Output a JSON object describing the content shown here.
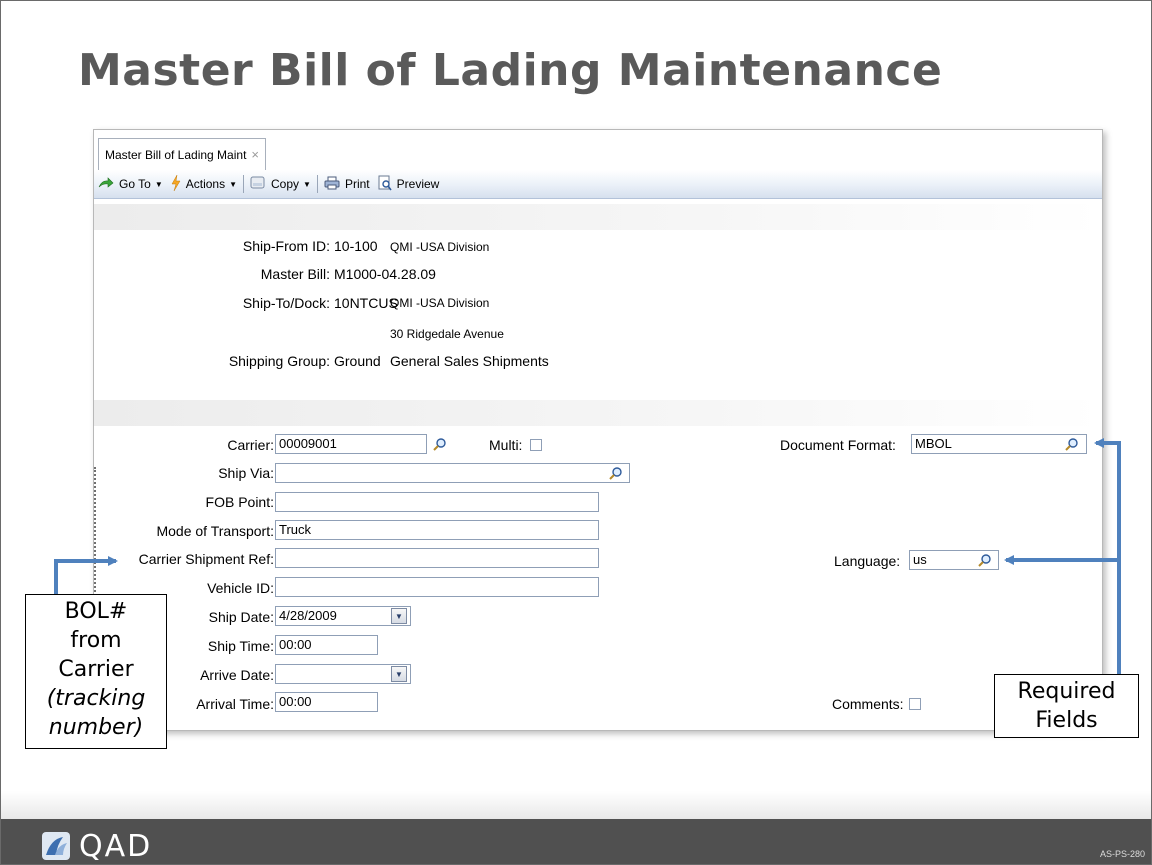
{
  "slide": {
    "title": "Master Bill of Lading Maintenance",
    "brand": "QAD",
    "code": "AS-PS-280"
  },
  "app": {
    "tab_label": "Master Bill of Lading Maint",
    "tab_close": "×",
    "toolbar": {
      "goto": "Go To",
      "actions": "Actions",
      "copy": "Copy",
      "print": "Print",
      "preview": "Preview"
    },
    "header": {
      "ship_from_label": "Ship-From ID:",
      "ship_from_value": "10-100",
      "ship_from_desc": "QMI -USA Division",
      "master_bill_label": "Master Bill:",
      "master_bill_value": "M1000-04.28.09",
      "ship_to_label": "Ship-To/Dock:",
      "ship_to_value": "10NTCUS",
      "ship_to_desc": "QMI -USA Division",
      "ship_to_address": "30 Ridgedale Avenue",
      "shipping_group_label": "Shipping Group:",
      "shipping_group_value": "Ground",
      "shipping_group_desc": "General Sales Shipments"
    },
    "form": {
      "carrier_label": "Carrier:",
      "carrier_value": "00009001",
      "multi_label": "Multi:",
      "document_format_label": "Document Format:",
      "document_format_value": "MBOL",
      "ship_via_label": "Ship Via:",
      "ship_via_value": "",
      "fob_label": "FOB Point:",
      "fob_value": "",
      "mode_label": "Mode of Transport:",
      "mode_value": "Truck",
      "carrier_ref_label": "Carrier Shipment Ref:",
      "carrier_ref_value": "",
      "language_label": "Language:",
      "language_value": "us",
      "vehicle_label": "Vehicle ID:",
      "vehicle_value": "",
      "ship_date_label": "Ship Date:",
      "ship_date_value": "4/28/2009",
      "ship_time_label": "Ship Time:",
      "ship_time_value": "00:00",
      "arrive_date_label": "Arrive Date:",
      "arrive_date_value": "",
      "arrival_time_label": "Arrival Time:",
      "arrival_time_value": "00:00",
      "comments_label": "Comments:"
    }
  },
  "callouts": {
    "bol": {
      "line1": "BOL#",
      "line2": "from",
      "line3": "Carrier",
      "line4": "(tracking",
      "line5": "number)"
    },
    "required": {
      "line1": "Required",
      "line2": "Fields"
    }
  },
  "colors": {
    "arrow": "#4f81bd",
    "title": "#5a5a5a",
    "footer": "#505050"
  }
}
